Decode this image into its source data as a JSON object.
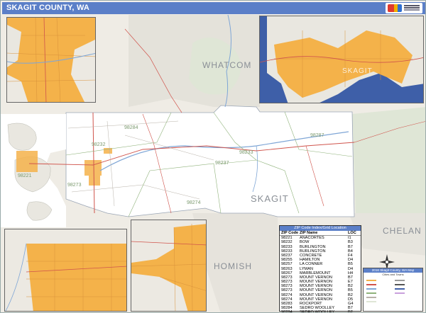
{
  "title": "SKAGIT COUNTY, WA",
  "labels": {
    "whatcom": "WHATCOM",
    "skagit": "SKAGIT",
    "chelan": "CHELAN",
    "snohomish": "HOMISH",
    "inset_skagit": "SKAGIT"
  },
  "zip_labels": [
    "98284",
    "98287",
    "98237",
    "98233",
    "98274",
    "98273",
    "98232",
    "98221"
  ],
  "index": {
    "header": "ZIP Code Index/Grid Location",
    "columns": [
      "ZIP Code",
      "ZIP Name",
      "LOC"
    ],
    "rows": [
      [
        "98221",
        "ANACORTES",
        "I1"
      ],
      [
        "98232",
        "BOW",
        "B3"
      ],
      [
        "98233",
        "BURLINGTON",
        "B7"
      ],
      [
        "98233",
        "BURLINGTON",
        "B4"
      ],
      [
        "98237",
        "CONCRETE",
        "F4"
      ],
      [
        "98255",
        "HAMILTON",
        "D4"
      ],
      [
        "98257",
        "LA CONNER",
        "B5"
      ],
      [
        "98263",
        "LYMAN",
        "D4"
      ],
      [
        "98267",
        "MARBLEMOUNT",
        "H4"
      ],
      [
        "98273",
        "MOUNT VERNON",
        "B7"
      ],
      [
        "98273",
        "MOUNT VERNON",
        "E7"
      ],
      [
        "98273",
        "MOUNT VERNON",
        "B2"
      ],
      [
        "98273",
        "MOUNT VERNON",
        "B5"
      ],
      [
        "98274",
        "MOUNT VERNON",
        "B2"
      ],
      [
        "98274",
        "MOUNT VERNON",
        "D5"
      ],
      [
        "98283",
        "ROCKPORT",
        "G4"
      ],
      [
        "98284",
        "SEDRO WOOLLEY",
        "B7"
      ],
      [
        "98284",
        "SEDRO WOOLLEY",
        "B2"
      ],
      [
        "98284",
        "SEDRO WOOLLEY",
        "E6"
      ]
    ]
  },
  "legend": {
    "title": "2016 Skagit County, WA Map",
    "subtitle": "Cities and Towns"
  },
  "colors": {
    "title_bar": "#5b7fc8",
    "urban": "#f4b24a",
    "water": "#3e5fa8",
    "land": "#f4f1ec",
    "county_fill": "#ffffff",
    "forest": "#dfe6d6"
  }
}
